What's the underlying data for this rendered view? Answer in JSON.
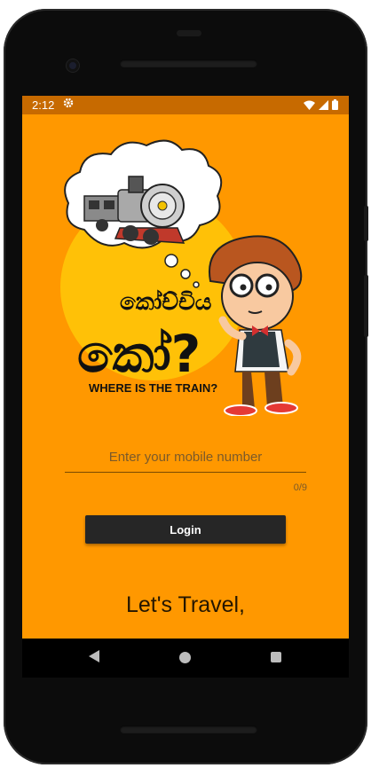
{
  "status_bar": {
    "time": "2:12",
    "gear_icon": "gear-icon",
    "wifi_icon": "wifi-icon",
    "signal_icon": "signal-icon",
    "battery_icon": "battery-icon"
  },
  "logo": {
    "sinhala_line1": "කෝච්චිය",
    "sinhala_line2": "කෝ?",
    "english_text": "WHERE IS THE TRAIN?"
  },
  "form": {
    "mobile_placeholder": "Enter your mobile number",
    "mobile_value": "",
    "char_counter": "0/9",
    "login_label": "Login"
  },
  "tagline": "Let's Travel,",
  "colors": {
    "screen_bg": "#FF9800",
    "status_bg": "#C76A00",
    "sun": "#FFC107",
    "button": "#262626"
  },
  "nav": {
    "back_icon": "back-icon",
    "home_icon": "home-icon",
    "recents_icon": "recents-icon"
  }
}
